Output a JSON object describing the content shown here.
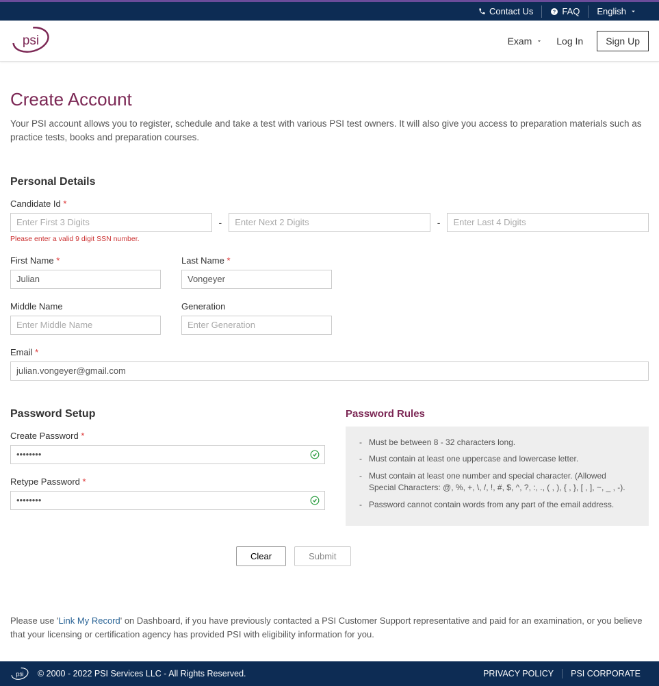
{
  "top_bar": {
    "contact": "Contact Us",
    "faq": "FAQ",
    "language": "English"
  },
  "header": {
    "exam": "Exam",
    "login": "Log In",
    "signup": "Sign Up"
  },
  "page": {
    "title": "Create Account",
    "description": "Your PSI account allows you to register, schedule and take a test with various PSI test owners. It will also give you access to preparation materials such as practice tests, books and preparation courses."
  },
  "personal": {
    "section_title": "Personal Details",
    "candidate_label": "Candidate Id",
    "candidate_ph1": "Enter First 3 Digits",
    "candidate_ph2": "Enter Next 2 Digits",
    "candidate_ph3": "Enter Last 4 Digits",
    "candidate_error": "Please enter a valid 9 digit SSN number.",
    "first_name_label": "First Name",
    "first_name_value": "Julian",
    "last_name_label": "Last Name",
    "last_name_value": "Vongeyer",
    "middle_name_label": "Middle Name",
    "middle_name_ph": "Enter Middle Name",
    "generation_label": "Generation",
    "generation_ph": "Enter Generation",
    "email_label": "Email",
    "email_value": "julian.vongeyer@gmail.com"
  },
  "password": {
    "section_title": "Password Setup",
    "create_label": "Create Password",
    "create_value": "••••••••",
    "retype_label": "Retype Password",
    "retype_value": "••••••••",
    "rules_title": "Password Rules",
    "rules": [
      "Must be between 8 - 32 characters long.",
      "Must contain at least one uppercase and lowercase letter.",
      "Must contain at least one number and special character. (Allowed Special Characters: @, %, +, \\, /, !, #, $, ^, ?, :, ., ( , ), { , }, [ , ], ~, _ , -).",
      "Password cannot contain words from any part of the email address."
    ]
  },
  "buttons": {
    "clear": "Clear",
    "submit": "Submit"
  },
  "bottom": {
    "prefix": "Please use '",
    "link": "Link My Record",
    "suffix": "' on Dashboard, if you have previously contacted a PSI Customer Support representative and paid for an examination, or you believe that your licensing or certification agency has provided PSI with eligibility information for you."
  },
  "footer": {
    "copyright": "© 2000 - 2022 PSI Services LLC - All Rights Reserved.",
    "privacy": "PRIVACY POLICY",
    "corporate": "PSI CORPORATE"
  }
}
